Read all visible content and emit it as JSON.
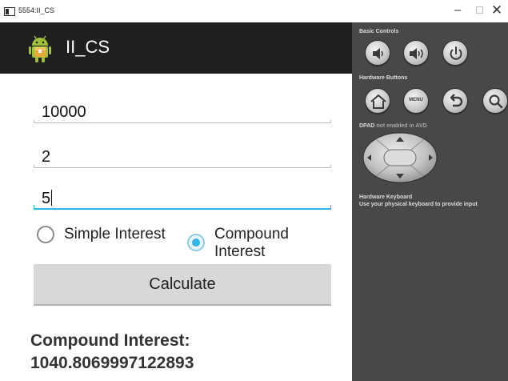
{
  "window": {
    "title": "5554:II_CS",
    "min_glyph": "–",
    "close_glyph": "✕"
  },
  "app": {
    "title": "II_CS",
    "icon": "android-icon",
    "accent_color": "#33b5e5",
    "actionbar_color": "#1f1f1f"
  },
  "form": {
    "principal_value": "10000",
    "rate_value": "2",
    "time_value": "5",
    "radio_simple_label": "Simple Interest",
    "radio_compound_label": "Compound Interest",
    "selected": "Compound Interest",
    "calculate_label": "Calculate"
  },
  "result": {
    "label": "Compound Interest:",
    "value": "1040.8069997122893"
  },
  "controls": {
    "basic_label": "Basic Controls",
    "hardware_buttons_label": "Hardware Buttons",
    "dpad_label_bold": "DPAD",
    "dpad_label_rest": " not enabled in AVD",
    "keyboard_line1": "Hardware Keyboard",
    "keyboard_line2": "Use your physical keyboard to provide input",
    "menu_button_text": "MENU",
    "icons": [
      "volume-down-icon",
      "volume-up-icon",
      "power-icon",
      "home-icon",
      "menu-icon",
      "back-icon",
      "search-icon",
      "dpad-icon"
    ]
  }
}
